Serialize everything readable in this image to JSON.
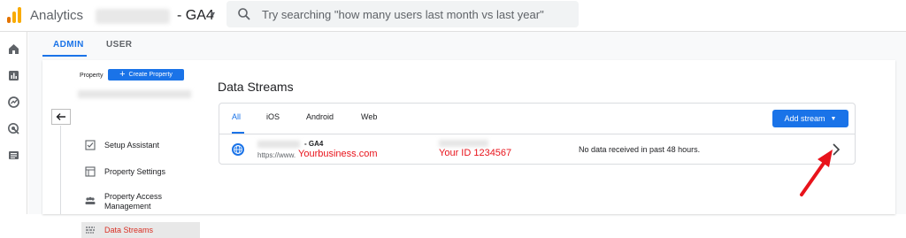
{
  "header": {
    "app_name": "Analytics",
    "account_suffix": "- GA4",
    "caret": "▾",
    "search_placeholder": "Try searching \"how many users last month vs last year\""
  },
  "left_rail": {
    "icons": [
      "home-icon",
      "reports-icon",
      "explore-icon",
      "advertising-icon",
      "configure-icon"
    ]
  },
  "tabs": [
    {
      "label": "ADMIN",
      "active": true
    },
    {
      "label": "USER",
      "active": false
    }
  ],
  "property": {
    "label": "Property",
    "create_button": "Create Property",
    "plus": "+"
  },
  "nav": [
    {
      "label": "Setup Assistant",
      "icon": "checkbox-icon"
    },
    {
      "label": "Property Settings",
      "icon": "settings-page-icon"
    },
    {
      "label": "Property Access Management",
      "icon": "people-icon"
    },
    {
      "label": "Data Streams",
      "icon": "data-streams-icon",
      "active": true
    }
  ],
  "data_streams": {
    "title": "Data Streams",
    "filters": [
      "All",
      "iOS",
      "Android",
      "Web"
    ],
    "add_button": "Add stream",
    "add_caret": "▼",
    "stream": {
      "name_suffix": "- GA4",
      "url_prefix": "https://www.",
      "url_annotation": "Yourbusiness.com",
      "id_annotation": "Your ID 1234567",
      "status": "No data received in past 48 hours."
    }
  },
  "colors": {
    "accent": "#1a73e8",
    "annotation_red": "#e8131b"
  }
}
